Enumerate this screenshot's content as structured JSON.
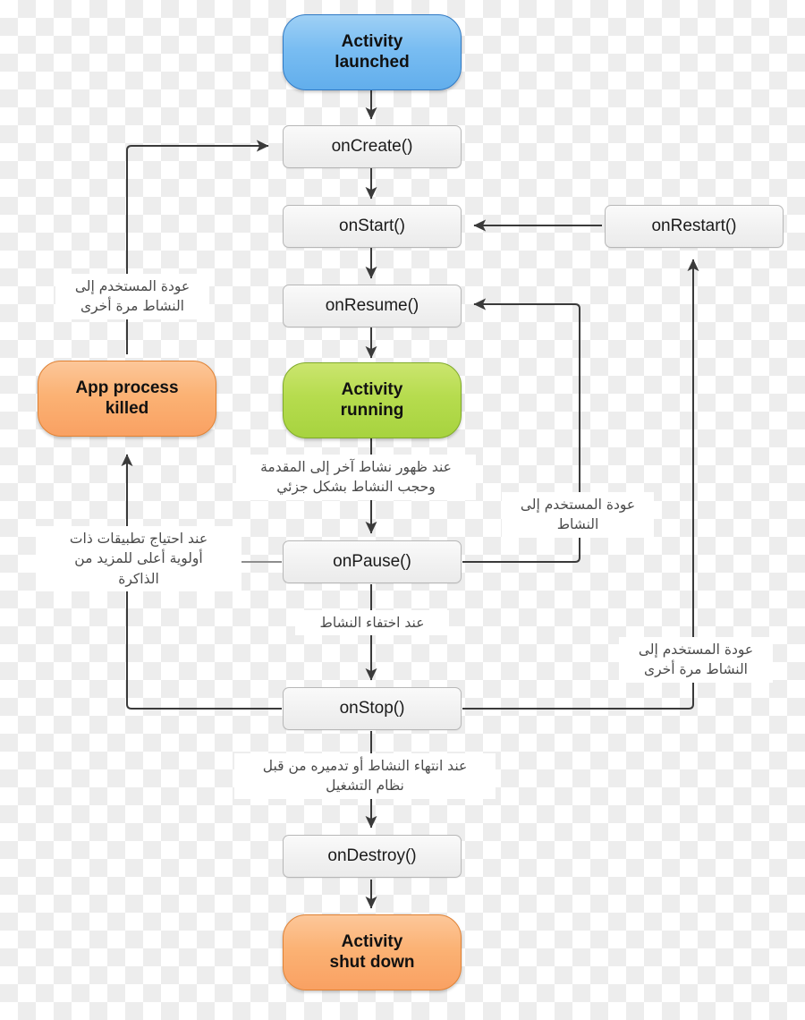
{
  "diagram": {
    "title": "Android Activity Lifecycle",
    "language": "ar",
    "background": "transparency-checkerboard",
    "colors": {
      "launched": "#79bdf2",
      "running": "#b6dc4e",
      "killed": "#fbb274",
      "shutdown": "#fbb274",
      "method_box": "#f1f1f1",
      "edge": "#3a3a3a",
      "note_text": "#4a4a4a"
    }
  },
  "nodes": {
    "activity_launched": {
      "label": "Activity\nlaunched",
      "line1": "Activity",
      "line2": "launched",
      "kind": "state",
      "color": "blue"
    },
    "on_create": {
      "label": "onCreate()",
      "kind": "method"
    },
    "on_start": {
      "label": "onStart()",
      "kind": "method"
    },
    "on_resume": {
      "label": "onResume()",
      "kind": "method"
    },
    "activity_running": {
      "line1": "Activity",
      "line2": "running",
      "kind": "state",
      "color": "green"
    },
    "on_pause": {
      "label": "onPause()",
      "kind": "method"
    },
    "on_stop": {
      "label": "onStop()",
      "kind": "method"
    },
    "on_restart": {
      "label": "onRestart()",
      "kind": "method"
    },
    "on_destroy": {
      "label": "onDestroy()",
      "kind": "method"
    },
    "app_process_killed": {
      "line1": "App process",
      "line2": "killed",
      "kind": "state",
      "color": "orange"
    },
    "activity_shut_down": {
      "line1": "Activity",
      "line2": "shut down",
      "kind": "state",
      "color": "orange"
    }
  },
  "notes": {
    "user_returns_again_left": "عودة المستخدم إلى\nالنشاط مرة أخرى",
    "higher_priority_apps_need_memory": "عند احتياج تطبيقات ذات\nأولوية أعلى للمزيد من\nالذاكرة",
    "another_activity_comes_to_foreground": "عند ظهور نشاط آخر إلى المقدمة\nوحجب النشاط بشكل جزئي",
    "user_returns_to_activity": "عودة المستخدم إلى\nالنشاط",
    "activity_no_longer_visible": "عند اختفاء النشاط",
    "user_returns_again_right": "عودة المستخدم إلى\nالنشاط مرة أخرى",
    "activity_finishing_or_destroyed": "عند انتهاء النشاط أو  تدميره من قبل\nنظام التشغيل"
  },
  "edges": [
    {
      "from": "activity_launched",
      "to": "on_create",
      "direction": "down"
    },
    {
      "from": "on_create",
      "to": "on_start",
      "direction": "down"
    },
    {
      "from": "on_start",
      "to": "on_resume",
      "direction": "down"
    },
    {
      "from": "on_resume",
      "to": "activity_running",
      "direction": "down"
    },
    {
      "from": "activity_running",
      "to": "on_pause",
      "direction": "down",
      "note": "another_activity_comes_to_foreground"
    },
    {
      "from": "on_pause",
      "to": "on_resume",
      "direction": "right-up",
      "note": "user_returns_to_activity"
    },
    {
      "from": "on_pause",
      "to": "on_stop",
      "direction": "down",
      "note": "activity_no_longer_visible"
    },
    {
      "from": "on_pause",
      "to": "app_process_killed",
      "direction": "left-up",
      "note": "higher_priority_apps_need_memory"
    },
    {
      "from": "on_stop",
      "to": "on_restart",
      "direction": "right-up",
      "note": "user_returns_again_right"
    },
    {
      "from": "on_restart",
      "to": "on_start",
      "direction": "left"
    },
    {
      "from": "on_stop",
      "to": "on_destroy",
      "direction": "down",
      "note": "activity_finishing_or_destroyed"
    },
    {
      "from": "on_destroy",
      "to": "activity_shut_down",
      "direction": "down"
    },
    {
      "from": "app_process_killed",
      "to": "on_create",
      "direction": "up-right",
      "note": "user_returns_again_left"
    }
  ]
}
